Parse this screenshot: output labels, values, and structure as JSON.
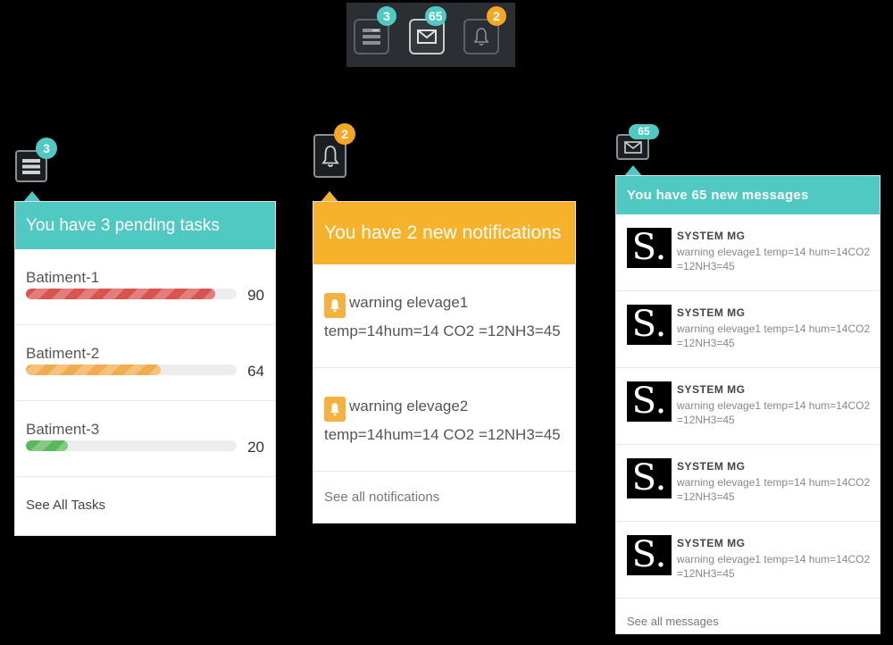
{
  "toolbar": {
    "tasks_badge": "3",
    "messages_badge": "65",
    "notifications_badge": "2"
  },
  "tasks": {
    "badge": "3",
    "header": "You have 3 pending tasks",
    "items": [
      {
        "label": "Batiment-1",
        "value": "90",
        "progress": 90,
        "color": "#d9534f"
      },
      {
        "label": "Batiment-2",
        "value": "64",
        "progress": 64,
        "color": "#f0ad4e"
      },
      {
        "label": "Batiment-3",
        "value": "20",
        "progress": 20,
        "color": "#5cb85c"
      }
    ],
    "footer": "See All Tasks"
  },
  "notifications": {
    "badge": "2",
    "header": "You have 2 new notifications",
    "items": [
      {
        "text": "warning elevage1 temp=14hum=14 CO2 =12NH3=45"
      },
      {
        "text": "warning elevage2 temp=14hum=14 CO2 =12NH3=45"
      }
    ],
    "footer": "See all notifications"
  },
  "messages": {
    "badge": "65",
    "header": "You have 65 new messages",
    "items": [
      {
        "avatar": "S.",
        "sender": "SYSTEM MG",
        "body": "warning elevage1 temp=14 hum=14CO2 =12NH3=45"
      },
      {
        "avatar": "S.",
        "sender": "SYSTEM MG",
        "body": "warning elevage1 temp=14 hum=14CO2 =12NH3=45"
      },
      {
        "avatar": "S.",
        "sender": "SYSTEM MG",
        "body": "warning elevage1 temp=14 hum=14CO2 =12NH3=45"
      },
      {
        "avatar": "S.",
        "sender": "SYSTEM MG",
        "body": "warning elevage1 temp=14 hum=14CO2 =12NH3=45"
      },
      {
        "avatar": "S.",
        "sender": "SYSTEM MG",
        "body": "warning elevage1 temp=14 hum=14CO2 =12NH3=45"
      }
    ],
    "footer": "See all messages"
  },
  "colors": {
    "teal": "#4fc9c1",
    "orange": "#f7b22b"
  }
}
